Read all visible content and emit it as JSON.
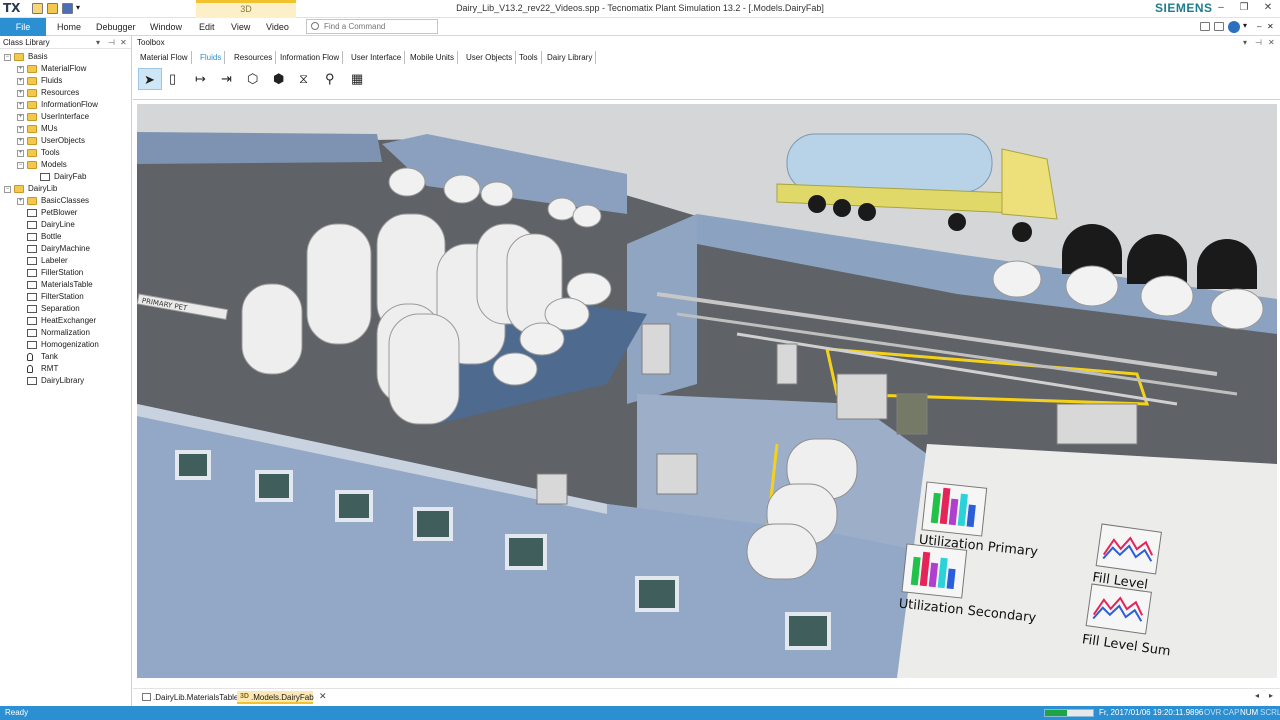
{
  "app": {
    "logo": "TX",
    "context_tab": "3D",
    "window_title": "Dairy_Lib_V13.2_rev22_Videos.spp - Tecnomatix Plant Simulation 13.2 - [.Models.DairyFab]",
    "brand": "SIEMENS"
  },
  "menu": {
    "file": "File",
    "items": [
      "Home",
      "Debugger",
      "Window",
      "Edit",
      "View",
      "Video"
    ],
    "search_placeholder": "Find a Command"
  },
  "class_library": {
    "title": "Class Library",
    "items": [
      {
        "label": "Basis",
        "level": 0,
        "icon": "folder-icon",
        "expand": "-"
      },
      {
        "label": "MaterialFlow",
        "level": 1,
        "icon": "folder-icon",
        "expand": "+"
      },
      {
        "label": "Fluids",
        "level": 1,
        "icon": "folder-icon",
        "expand": "+"
      },
      {
        "label": "Resources",
        "level": 1,
        "icon": "folder-icon",
        "expand": "+"
      },
      {
        "label": "InformationFlow",
        "level": 1,
        "icon": "folder-icon",
        "expand": "+"
      },
      {
        "label": "UserInterface",
        "level": 1,
        "icon": "folder-icon",
        "expand": "+"
      },
      {
        "label": "MUs",
        "level": 1,
        "icon": "folder-icon",
        "expand": "+"
      },
      {
        "label": "UserObjects",
        "level": 1,
        "icon": "folder-icon",
        "expand": "+"
      },
      {
        "label": "Tools",
        "level": 1,
        "icon": "folder-icon",
        "expand": "+"
      },
      {
        "label": "Models",
        "level": 1,
        "icon": "folder-icon",
        "expand": "-"
      },
      {
        "label": "DairyFab",
        "level": 2,
        "icon": "frame-icon",
        "expand": ""
      },
      {
        "label": "DairyLib",
        "level": 0,
        "icon": "folder-icon",
        "expand": "-"
      },
      {
        "label": "BasicClasses",
        "level": 1,
        "icon": "folder-icon",
        "expand": "+"
      },
      {
        "label": "PetBlower",
        "level": 1,
        "icon": "frame-icon",
        "expand": ""
      },
      {
        "label": "DairyLine",
        "level": 1,
        "icon": "frame-icon",
        "expand": ""
      },
      {
        "label": "Bottle",
        "level": 1,
        "icon": "frame-icon",
        "expand": ""
      },
      {
        "label": "DairyMachine",
        "level": 1,
        "icon": "frame-icon",
        "expand": ""
      },
      {
        "label": "Labeler",
        "level": 1,
        "icon": "frame-icon",
        "expand": ""
      },
      {
        "label": "FillerStation",
        "level": 1,
        "icon": "frame-icon",
        "expand": ""
      },
      {
        "label": "MaterialsTable",
        "level": 1,
        "icon": "frame-icon",
        "expand": ""
      },
      {
        "label": "FilterStation",
        "level": 1,
        "icon": "frame-icon",
        "expand": ""
      },
      {
        "label": "Separation",
        "level": 1,
        "icon": "frame-icon",
        "expand": ""
      },
      {
        "label": "HeatExchanger",
        "level": 1,
        "icon": "frame-icon",
        "expand": ""
      },
      {
        "label": "Normalization",
        "level": 1,
        "icon": "frame-icon",
        "expand": ""
      },
      {
        "label": "Homogenization",
        "level": 1,
        "icon": "frame-icon",
        "expand": ""
      },
      {
        "label": "Tank",
        "level": 1,
        "icon": "tank-icon",
        "expand": ""
      },
      {
        "label": "RMT",
        "level": 1,
        "icon": "tank-icon",
        "expand": ""
      },
      {
        "label": "DairyLibrary",
        "level": 1,
        "icon": "frame-icon",
        "expand": ""
      }
    ]
  },
  "toolbox": {
    "title": "Toolbox",
    "tabs": [
      "Material Flow",
      "Fluids",
      "Resources",
      "Information Flow",
      "User Interface",
      "Mobile Units",
      "User Objects",
      "Tools",
      "Dairy Library"
    ],
    "active_tab": "Fluids",
    "tools": [
      {
        "name": "pointer-tool",
        "glyph": "➤"
      },
      {
        "name": "tank-tool",
        "glyph": "▯"
      },
      {
        "name": "source-tool",
        "glyph": "↦"
      },
      {
        "name": "drain-tool",
        "glyph": "⇥"
      },
      {
        "name": "mixer-tool",
        "glyph": "⬡"
      },
      {
        "name": "flow-control-tool",
        "glyph": "⬢"
      },
      {
        "name": "valve-tool",
        "glyph": "⧖"
      },
      {
        "name": "pump-tool",
        "glyph": "⚲"
      },
      {
        "name": "pipe-table-tool",
        "glyph": "▦"
      }
    ]
  },
  "viewport": {
    "labels": {
      "util_primary": "Utilization Primary",
      "util_secondary": "Utilization Secondary",
      "fill_level": "Fill Level",
      "fill_level_sum": "Fill Level Sum",
      "wall_sign": "PRIMARY PET"
    }
  },
  "doc_tabs": [
    {
      "label": ".DairyLib.MaterialsTable",
      "active": false
    },
    {
      "label": ".Models.DairyFab",
      "active": true
    }
  ],
  "status": {
    "text": "Ready",
    "progress": 0.45,
    "sim_time": "Fr, 2017/01/06 19:20:11.9896",
    "indicators": [
      "OVR",
      "CAP",
      "NUM",
      "SCRL"
    ]
  },
  "colors": {
    "accent": "#2b8fd1",
    "context_tab": "#f2c12e",
    "brand": "#1c7d8c"
  }
}
